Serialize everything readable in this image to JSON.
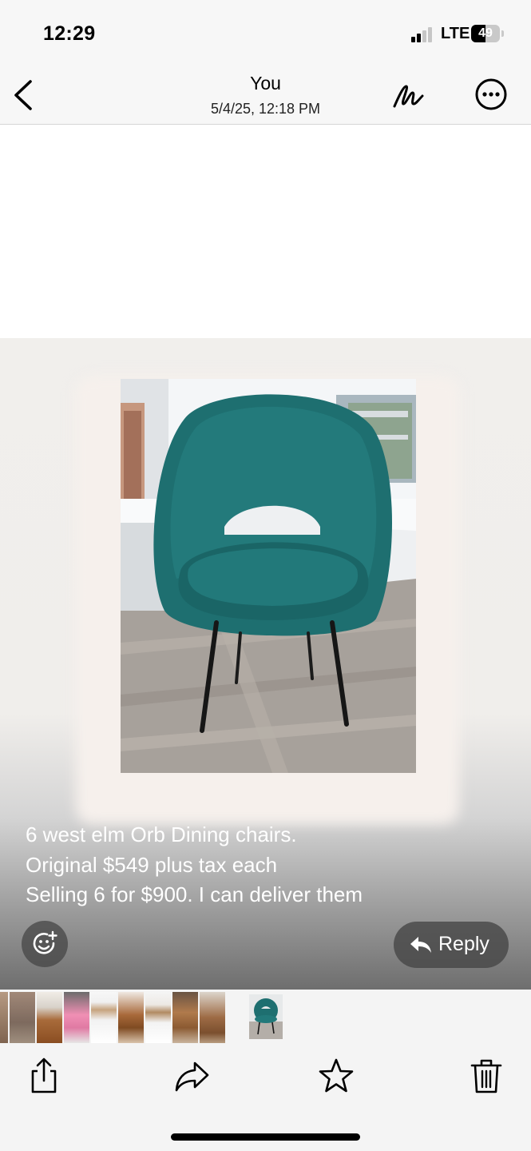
{
  "status_bar": {
    "time": "12:29",
    "network": "LTE",
    "battery": "49"
  },
  "nav": {
    "title": "You",
    "subtitle": "5/4/25, 12:18 PM",
    "icons": [
      "chevron-left-icon",
      "markup-pen-icon",
      "ellipsis-circle-icon"
    ]
  },
  "photo": {
    "subject": "teal upholstered dining chair",
    "colors": {
      "fabric": "#1e6f6f",
      "legs": "#161616",
      "floor": "#a8a29c"
    }
  },
  "caption": {
    "lines": [
      "6 west elm  Orb Dining chairs.",
      "Original $549 plus tax each",
      "Selling 6 for $900.  I can deliver them"
    ]
  },
  "actions": {
    "reply_label": "Reply",
    "emoji_icon": "add-reaction-icon",
    "reply_icon": "reply-arrow-icon"
  },
  "thumbnails": {
    "count": 10,
    "selected_index": 9
  },
  "toolbar": {
    "icons": [
      "share-icon",
      "forward-icon",
      "star-icon",
      "trash-icon"
    ]
  }
}
